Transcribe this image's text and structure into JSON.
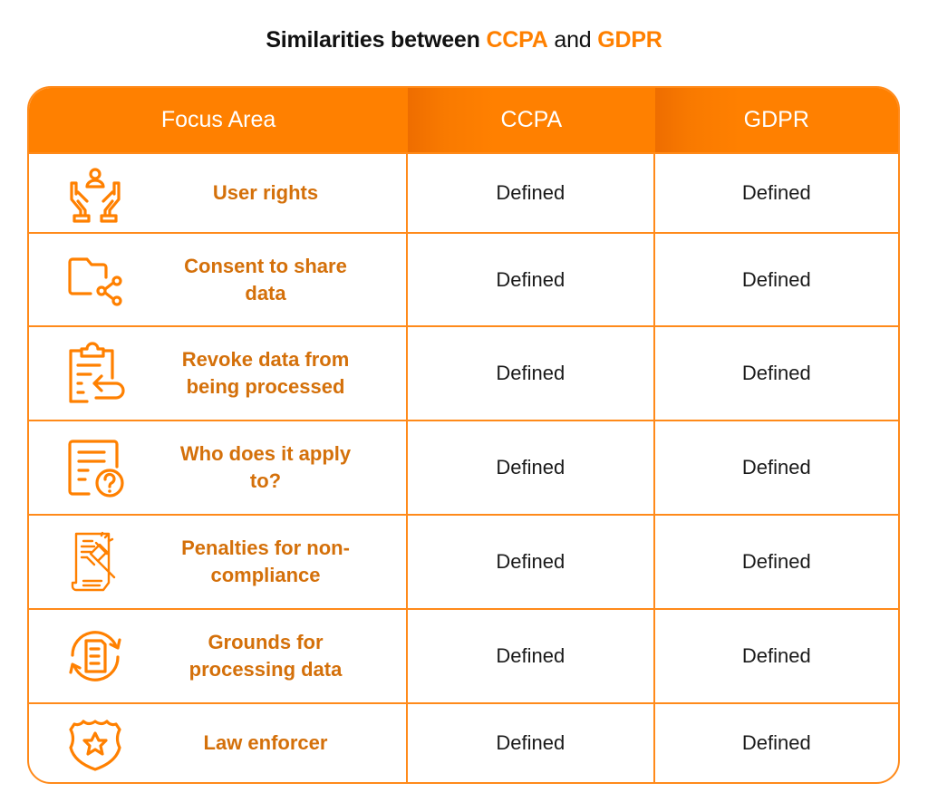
{
  "title": {
    "prefix": "Similarities between ",
    "term1": "CCPA",
    "middle": " and ",
    "term2": "GDPR"
  },
  "colors": {
    "accent": "#ff8000",
    "label_text": "#d4700a",
    "value_text": "#1a1a1a"
  },
  "table": {
    "headers": [
      "Focus Area",
      "CCPA",
      "GDPR"
    ],
    "rows": [
      {
        "icon": "hands-user-icon",
        "focus_area": "User rights",
        "ccpa": "Defined",
        "gdpr": "Defined"
      },
      {
        "icon": "folder-share-icon",
        "focus_area": "Consent to share data",
        "ccpa": "Defined",
        "gdpr": "Defined"
      },
      {
        "icon": "clipboard-return-icon",
        "focus_area": "Revoke data from being processed",
        "ccpa": "Defined",
        "gdpr": "Defined"
      },
      {
        "icon": "document-question-icon",
        "focus_area": "Who does it apply to?",
        "ccpa": "Defined",
        "gdpr": "Defined"
      },
      {
        "icon": "gavel-document-icon",
        "focus_area": "Penalties for non-compliance",
        "ccpa": "Defined",
        "gdpr": "Defined"
      },
      {
        "icon": "document-cycle-icon",
        "focus_area": "Grounds for processing data",
        "ccpa": "Defined",
        "gdpr": "Defined"
      },
      {
        "icon": "police-badge-icon",
        "focus_area": "Law enforcer",
        "ccpa": "Defined",
        "gdpr": "Defined"
      }
    ]
  }
}
